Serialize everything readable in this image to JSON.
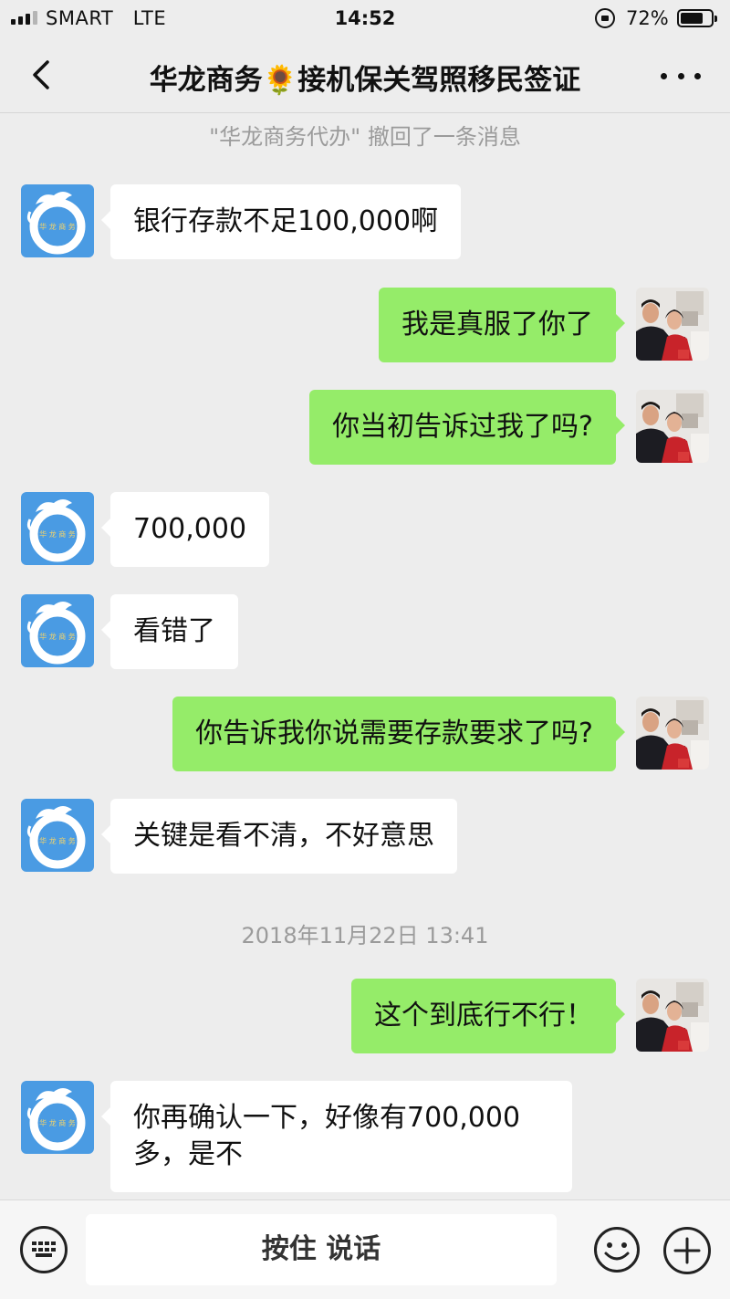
{
  "status_bar": {
    "carrier": "SMART",
    "network": "LTE",
    "time": "14:52",
    "battery": "72%"
  },
  "header": {
    "title": "华龙商务🌻接机保关驾照移民签证"
  },
  "system": {
    "recall": "\"华龙商务代办\" 撤回了一条消息",
    "timestamp": "2018年11月22日 13:41"
  },
  "messages": [
    {
      "side": "in",
      "text": "银行存款不足100,000啊"
    },
    {
      "side": "out",
      "text": "我是真服了你了"
    },
    {
      "side": "out",
      "text": "你当初告诉过我了吗?"
    },
    {
      "side": "in",
      "text": "700,000"
    },
    {
      "side": "in",
      "text": "看错了"
    },
    {
      "side": "out",
      "text": "你告诉我你说需要存款要求了吗?"
    },
    {
      "side": "in",
      "text": "关键是看不清，不好意思"
    },
    {
      "side": "out",
      "text": "这个到底行不行！"
    },
    {
      "side": "in",
      "text": "你再确认一下，好像有700,000多，是不"
    }
  ],
  "input": {
    "hold_to_talk": "按住 说话"
  },
  "colors": {
    "background": "#ededed",
    "outgoing_bubble": "#95ec69",
    "incoming_bubble": "#ffffff",
    "contact_avatar": "#4a9be3"
  }
}
